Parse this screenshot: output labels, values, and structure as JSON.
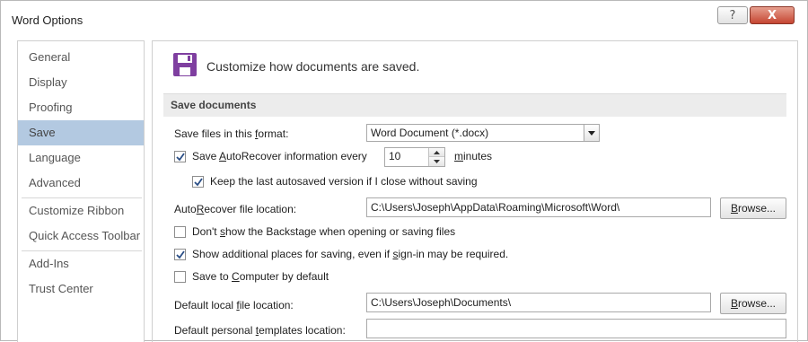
{
  "window": {
    "title": "Word Options",
    "help_glyph": "?",
    "close_glyph": "X"
  },
  "sidebar": {
    "items": [
      {
        "label": "General"
      },
      {
        "label": "Display"
      },
      {
        "label": "Proofing"
      },
      {
        "label": "Save",
        "active": true
      },
      {
        "label": "Language"
      },
      {
        "label": "Advanced"
      },
      {
        "label": "Customize Ribbon"
      },
      {
        "label": "Quick Access Toolbar"
      },
      {
        "label": "Add-Ins"
      },
      {
        "label": "Trust Center"
      }
    ]
  },
  "header": {
    "text": "Customize how documents are saved."
  },
  "save_documents": {
    "section_title": "Save documents",
    "format_label_pre": "Save files in this ",
    "format_label_key": "f",
    "format_label_post": "ormat:",
    "format_value": "Word Document (*.docx)",
    "autorecover_checked": true,
    "autorecover_label_pre": "Save ",
    "autorecover_label_key": "A",
    "autorecover_label_post": "utoRecover information every",
    "autorecover_minutes": "10",
    "minutes_label_key": "m",
    "minutes_label_post": "inutes",
    "keep_last_checked": true,
    "keep_last_label": "Keep the last autosaved version if I close without saving",
    "autorecover_location_label_pre": "Auto",
    "autorecover_location_label_key": "R",
    "autorecover_location_label_post": "ecover file location:",
    "autorecover_location_value": "C:\\Users\\Joseph\\AppData\\Roaming\\Microsoft\\Word\\",
    "browse_label_key": "B",
    "browse_label_post": "rowse...",
    "backstage_checked": false,
    "backstage_label_pre": "Don't ",
    "backstage_label_key": "s",
    "backstage_label_post": "how the Backstage when opening or saving files",
    "additional_places_checked": true,
    "additional_places_label_pre": "Show additional places for saving, even if ",
    "additional_places_label_key": "s",
    "additional_places_label_post": "ign-in may be required.",
    "save_computer_checked": false,
    "save_computer_label_pre": "Save to ",
    "save_computer_label_key": "C",
    "save_computer_label_post": "omputer by default",
    "default_local_label_pre": "Default local ",
    "default_local_label_key": "f",
    "default_local_label_post": "ile location:",
    "default_local_value": "C:\\Users\\Joseph\\Documents\\",
    "templates_label_pre": "Default personal ",
    "templates_label_key": "t",
    "templates_label_post": "emplates location:",
    "templates_value": ""
  },
  "colors": {
    "accent_purple": "#7f3fa0",
    "nav_active": "#b3c9e1",
    "close_button": "#c54632"
  }
}
